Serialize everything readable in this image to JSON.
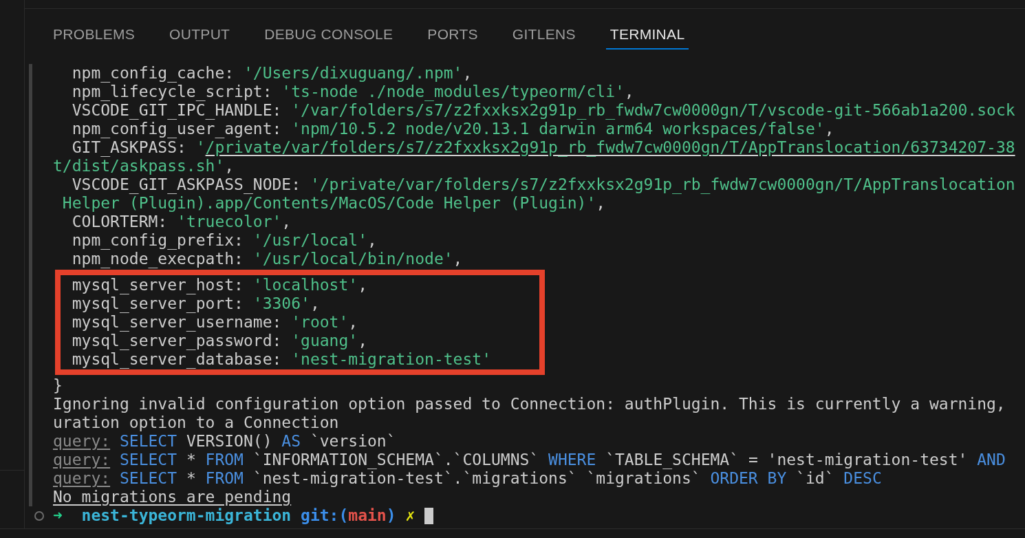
{
  "panel_tabs": [
    {
      "label": "PROBLEMS",
      "selected": false
    },
    {
      "label": "OUTPUT",
      "selected": false
    },
    {
      "label": "DEBUG CONSOLE",
      "selected": false
    },
    {
      "label": "PORTS",
      "selected": false
    },
    {
      "label": "GITLENS",
      "selected": false
    },
    {
      "label": "TERMINAL",
      "selected": true
    }
  ],
  "terminal": {
    "lines": [
      {
        "highlighted": false,
        "segments": [
          {
            "kind": "plain",
            "text": "  npm_config_cache: "
          },
          {
            "kind": "string",
            "text": "'/Users/dixuguang/.npm'"
          },
          {
            "kind": "plain",
            "text": ","
          }
        ]
      },
      {
        "highlighted": false,
        "segments": [
          {
            "kind": "plain",
            "text": "  npm_lifecycle_script: "
          },
          {
            "kind": "string",
            "text": "'ts-node ./node_modules/typeorm/cli'"
          },
          {
            "kind": "plain",
            "text": ","
          }
        ]
      },
      {
        "highlighted": false,
        "segments": [
          {
            "kind": "plain",
            "text": "  VSCODE_GIT_IPC_HANDLE: "
          },
          {
            "kind": "string",
            "text": "'/var/folders/s7/z2fxxksx2g91p_rb_fwdw7cw0000gn/T/vscode-git-566ab1a200.sock"
          }
        ]
      },
      {
        "highlighted": false,
        "segments": [
          {
            "kind": "plain",
            "text": "  npm_config_user_agent: "
          },
          {
            "kind": "string",
            "text": "'npm/10.5.2 node/v20.13.1 darwin arm64 workspaces/false'"
          },
          {
            "kind": "plain",
            "text": ","
          }
        ]
      },
      {
        "highlighted": false,
        "segments": [
          {
            "kind": "plain",
            "text": "  GIT_ASKPASS: "
          },
          {
            "kind": "string",
            "text": "'"
          },
          {
            "kind": "link",
            "text": "/private/var/folders/s7/z2fxxksx2g91p_rb_fwdw7cw0000gn/T/AppTranslocation/63734207-38"
          }
        ]
      },
      {
        "highlighted": false,
        "segments": [
          {
            "kind": "string",
            "text": "t/dist/askpass.sh'"
          },
          {
            "kind": "plain",
            "text": ","
          }
        ]
      },
      {
        "highlighted": false,
        "segments": [
          {
            "kind": "plain",
            "text": "  VSCODE_GIT_ASKPASS_NODE: "
          },
          {
            "kind": "string",
            "text": "'/private/var/folders/s7/z2fxxksx2g91p_rb_fwdw7cw0000gn/T/AppTranslocation"
          }
        ]
      },
      {
        "highlighted": false,
        "segments": [
          {
            "kind": "string",
            "text": " Helper (Plugin).app/Contents/MacOS/Code Helper (Plugin)'"
          },
          {
            "kind": "plain",
            "text": ","
          }
        ]
      },
      {
        "highlighted": false,
        "segments": [
          {
            "kind": "plain",
            "text": "  COLORTERM: "
          },
          {
            "kind": "string",
            "text": "'truecolor'"
          },
          {
            "kind": "plain",
            "text": ","
          }
        ]
      },
      {
        "highlighted": false,
        "segments": [
          {
            "kind": "plain",
            "text": "  npm_config_prefix: "
          },
          {
            "kind": "string",
            "text": "'/usr/local'"
          },
          {
            "kind": "plain",
            "text": ","
          }
        ]
      },
      {
        "highlighted": false,
        "segments": [
          {
            "kind": "plain",
            "text": "  npm_node_execpath: "
          },
          {
            "kind": "string",
            "text": "'/usr/local/bin/node'"
          },
          {
            "kind": "plain",
            "text": ","
          }
        ]
      },
      {
        "highlighted": true,
        "segments": [
          {
            "kind": "plain",
            "text": "  mysql_server_host: "
          },
          {
            "kind": "string",
            "text": "'localhost'"
          },
          {
            "kind": "plain",
            "text": ","
          }
        ]
      },
      {
        "highlighted": true,
        "segments": [
          {
            "kind": "plain",
            "text": "  mysql_server_port: "
          },
          {
            "kind": "string",
            "text": "'3306'"
          },
          {
            "kind": "plain",
            "text": ","
          }
        ]
      },
      {
        "highlighted": true,
        "segments": [
          {
            "kind": "plain",
            "text": "  mysql_server_username: "
          },
          {
            "kind": "string",
            "text": "'root'"
          },
          {
            "kind": "plain",
            "text": ","
          }
        ]
      },
      {
        "highlighted": true,
        "segments": [
          {
            "kind": "plain",
            "text": "  mysql_server_password: "
          },
          {
            "kind": "string",
            "text": "'guang'"
          },
          {
            "kind": "plain",
            "text": ","
          }
        ]
      },
      {
        "highlighted": true,
        "segments": [
          {
            "kind": "plain",
            "text": "  mysql_server_database: "
          },
          {
            "kind": "string",
            "text": "'nest-migration-test'"
          }
        ]
      },
      {
        "highlighted": false,
        "segments": [
          {
            "kind": "plain",
            "text": "}"
          }
        ]
      },
      {
        "highlighted": false,
        "segments": [
          {
            "kind": "plain",
            "text": "Ignoring invalid configuration option passed to Connection: authPlugin. This is currently a warning,"
          }
        ]
      },
      {
        "highlighted": false,
        "segments": [
          {
            "kind": "plain",
            "text": "uration option to a Connection"
          }
        ]
      },
      {
        "highlighted": false,
        "segments": [
          {
            "kind": "label",
            "text": "query:"
          },
          {
            "kind": "keyword",
            "text": " SELECT"
          },
          {
            "kind": "plain",
            "text": " VERSION() "
          },
          {
            "kind": "keyword",
            "text": "AS"
          },
          {
            "kind": "plain",
            "text": " `version`"
          }
        ]
      },
      {
        "highlighted": false,
        "segments": [
          {
            "kind": "label",
            "text": "query:"
          },
          {
            "kind": "keyword",
            "text": " SELECT"
          },
          {
            "kind": "plain",
            "text": " * "
          },
          {
            "kind": "keyword",
            "text": "FROM"
          },
          {
            "kind": "plain",
            "text": " `INFORMATION_SCHEMA`.`COLUMNS` "
          },
          {
            "kind": "keyword",
            "text": "WHERE"
          },
          {
            "kind": "plain",
            "text": " `TABLE_SCHEMA` = 'nest-migration-test' "
          },
          {
            "kind": "keyword",
            "text": "AND"
          }
        ]
      },
      {
        "highlighted": false,
        "segments": [
          {
            "kind": "label",
            "text": "query:"
          },
          {
            "kind": "keyword",
            "text": " SELECT"
          },
          {
            "kind": "plain",
            "text": " * "
          },
          {
            "kind": "keyword",
            "text": "FROM"
          },
          {
            "kind": "plain",
            "text": " `nest-migration-test`.`migrations` `migrations` "
          },
          {
            "kind": "keyword",
            "text": "ORDER BY"
          },
          {
            "kind": "plain",
            "text": " `id` "
          },
          {
            "kind": "keyword",
            "text": "DESC"
          }
        ]
      },
      {
        "highlighted": false,
        "segments": [
          {
            "kind": "underlined",
            "text": "No migrations are pending"
          }
        ]
      }
    ],
    "prompt": {
      "segments": [
        {
          "kind": "arrow",
          "text": "➜"
        },
        {
          "kind": "directory",
          "text": "  nest-typeorm-migration"
        },
        {
          "kind": "git",
          "text": " git:("
        },
        {
          "kind": "branch",
          "text": "main"
        },
        {
          "kind": "git",
          "text": ")"
        },
        {
          "kind": "dirty",
          "text": " ✗"
        }
      ],
      "cursor": true
    }
  }
}
